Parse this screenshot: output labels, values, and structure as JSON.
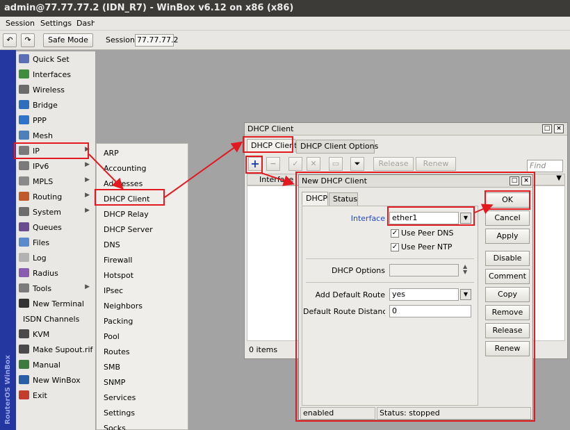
{
  "window_title": "admin@77.77.77.2 (IDN_R7) - WinBox v6.12 on x86 (x86)",
  "menubar": [
    "Session",
    "Settings",
    "Dashboard"
  ],
  "toolbar": {
    "safe_mode": "Safe Mode",
    "session_label": "Session",
    "session_value": "77.77.77.2"
  },
  "vertical_label": "RouterOS WinBox",
  "sidebar": [
    {
      "label": "Quick Set",
      "icon": "quick-set-icon",
      "color": "#5a6fb5"
    },
    {
      "label": "Interfaces",
      "icon": "interfaces-icon",
      "color": "#3f8c3f"
    },
    {
      "label": "Wireless",
      "icon": "wireless-icon",
      "color": "#6b6b6b"
    },
    {
      "label": "Bridge",
      "icon": "bridge-icon",
      "color": "#2e6fbd"
    },
    {
      "label": "PPP",
      "icon": "ppp-icon",
      "color": "#2f74c8"
    },
    {
      "label": "Mesh",
      "icon": "mesh-icon",
      "color": "#4d7fb8"
    },
    {
      "label": "IP",
      "icon": "ip-icon",
      "color": "#7a7a7a",
      "submenu": true
    },
    {
      "label": "IPv6",
      "icon": "ipv6-icon",
      "color": "#7a7a7a",
      "submenu": true
    },
    {
      "label": "MPLS",
      "icon": "mpls-icon",
      "color": "#8a8a8a",
      "submenu": true
    },
    {
      "label": "Routing",
      "icon": "routing-icon",
      "color": "#c05a2a",
      "submenu": true
    },
    {
      "label": "System",
      "icon": "system-icon",
      "color": "#6d6d6d",
      "submenu": true
    },
    {
      "label": "Queues",
      "icon": "queues-icon",
      "color": "#6b4d8f"
    },
    {
      "label": "Files",
      "icon": "files-icon",
      "color": "#5a8acb"
    },
    {
      "label": "Log",
      "icon": "log-icon",
      "color": "#b2b2b2"
    },
    {
      "label": "Radius",
      "icon": "radius-icon",
      "color": "#8a5cb0"
    },
    {
      "label": "Tools",
      "icon": "tools-icon",
      "color": "#7b7b7b",
      "submenu": true
    },
    {
      "label": "New Terminal",
      "icon": "terminal-icon",
      "color": "#333333"
    },
    {
      "label": "ISDN Channels",
      "icon": "",
      "color": ""
    },
    {
      "label": "KVM",
      "icon": "kvm-icon",
      "color": "#4a4a4a"
    },
    {
      "label": "Make Supout.rif",
      "icon": "supout-icon",
      "color": "#4a4a4a"
    },
    {
      "label": "Manual",
      "icon": "manual-icon",
      "color": "#3d7a3d"
    },
    {
      "label": "New WinBox",
      "icon": "winbox-icon",
      "color": "#2a5fa8"
    },
    {
      "label": "Exit",
      "icon": "exit-icon",
      "color": "#c43c2c"
    }
  ],
  "ip_submenu": [
    "ARP",
    "Accounting",
    "Addresses",
    "DHCP Client",
    "DHCP Relay",
    "DHCP Server",
    "DNS",
    "Firewall",
    "Hotspot",
    "IPsec",
    "Neighbors",
    "Packing",
    "Pool",
    "Routes",
    "SMB",
    "SNMP",
    "Services",
    "Settings",
    "Socks"
  ],
  "dhcp_window": {
    "title": "DHCP Client",
    "tabs": [
      "DHCP Client",
      "DHCP Client Options"
    ],
    "buttons": {
      "release": "Release",
      "renew": "Renew"
    },
    "find_placeholder": "Find",
    "column": "Interface",
    "count": "0 items"
  },
  "new_dialog": {
    "title": "New DHCP Client",
    "tabs": [
      "DHCP",
      "Status"
    ],
    "interface_label": "Interface",
    "interface_value": "ether1",
    "use_peer_dns": "Use Peer DNS",
    "use_peer_ntp": "Use Peer NTP",
    "dhcp_options_label": "DHCP Options",
    "add_default_route_label": "Add Default Route",
    "add_default_route_value": "yes",
    "default_route_distance_label": "Default Route Distance",
    "default_route_distance_value": "0",
    "buttons": [
      "OK",
      "Cancel",
      "Apply",
      "Disable",
      "Comment",
      "Copy",
      "Remove",
      "Release",
      "Renew"
    ],
    "status_left": "enabled",
    "status_right": "Status: stopped"
  },
  "colors": {
    "highlight": "#e3191f",
    "strip": "#2436a0",
    "title": "#3c3b37"
  }
}
